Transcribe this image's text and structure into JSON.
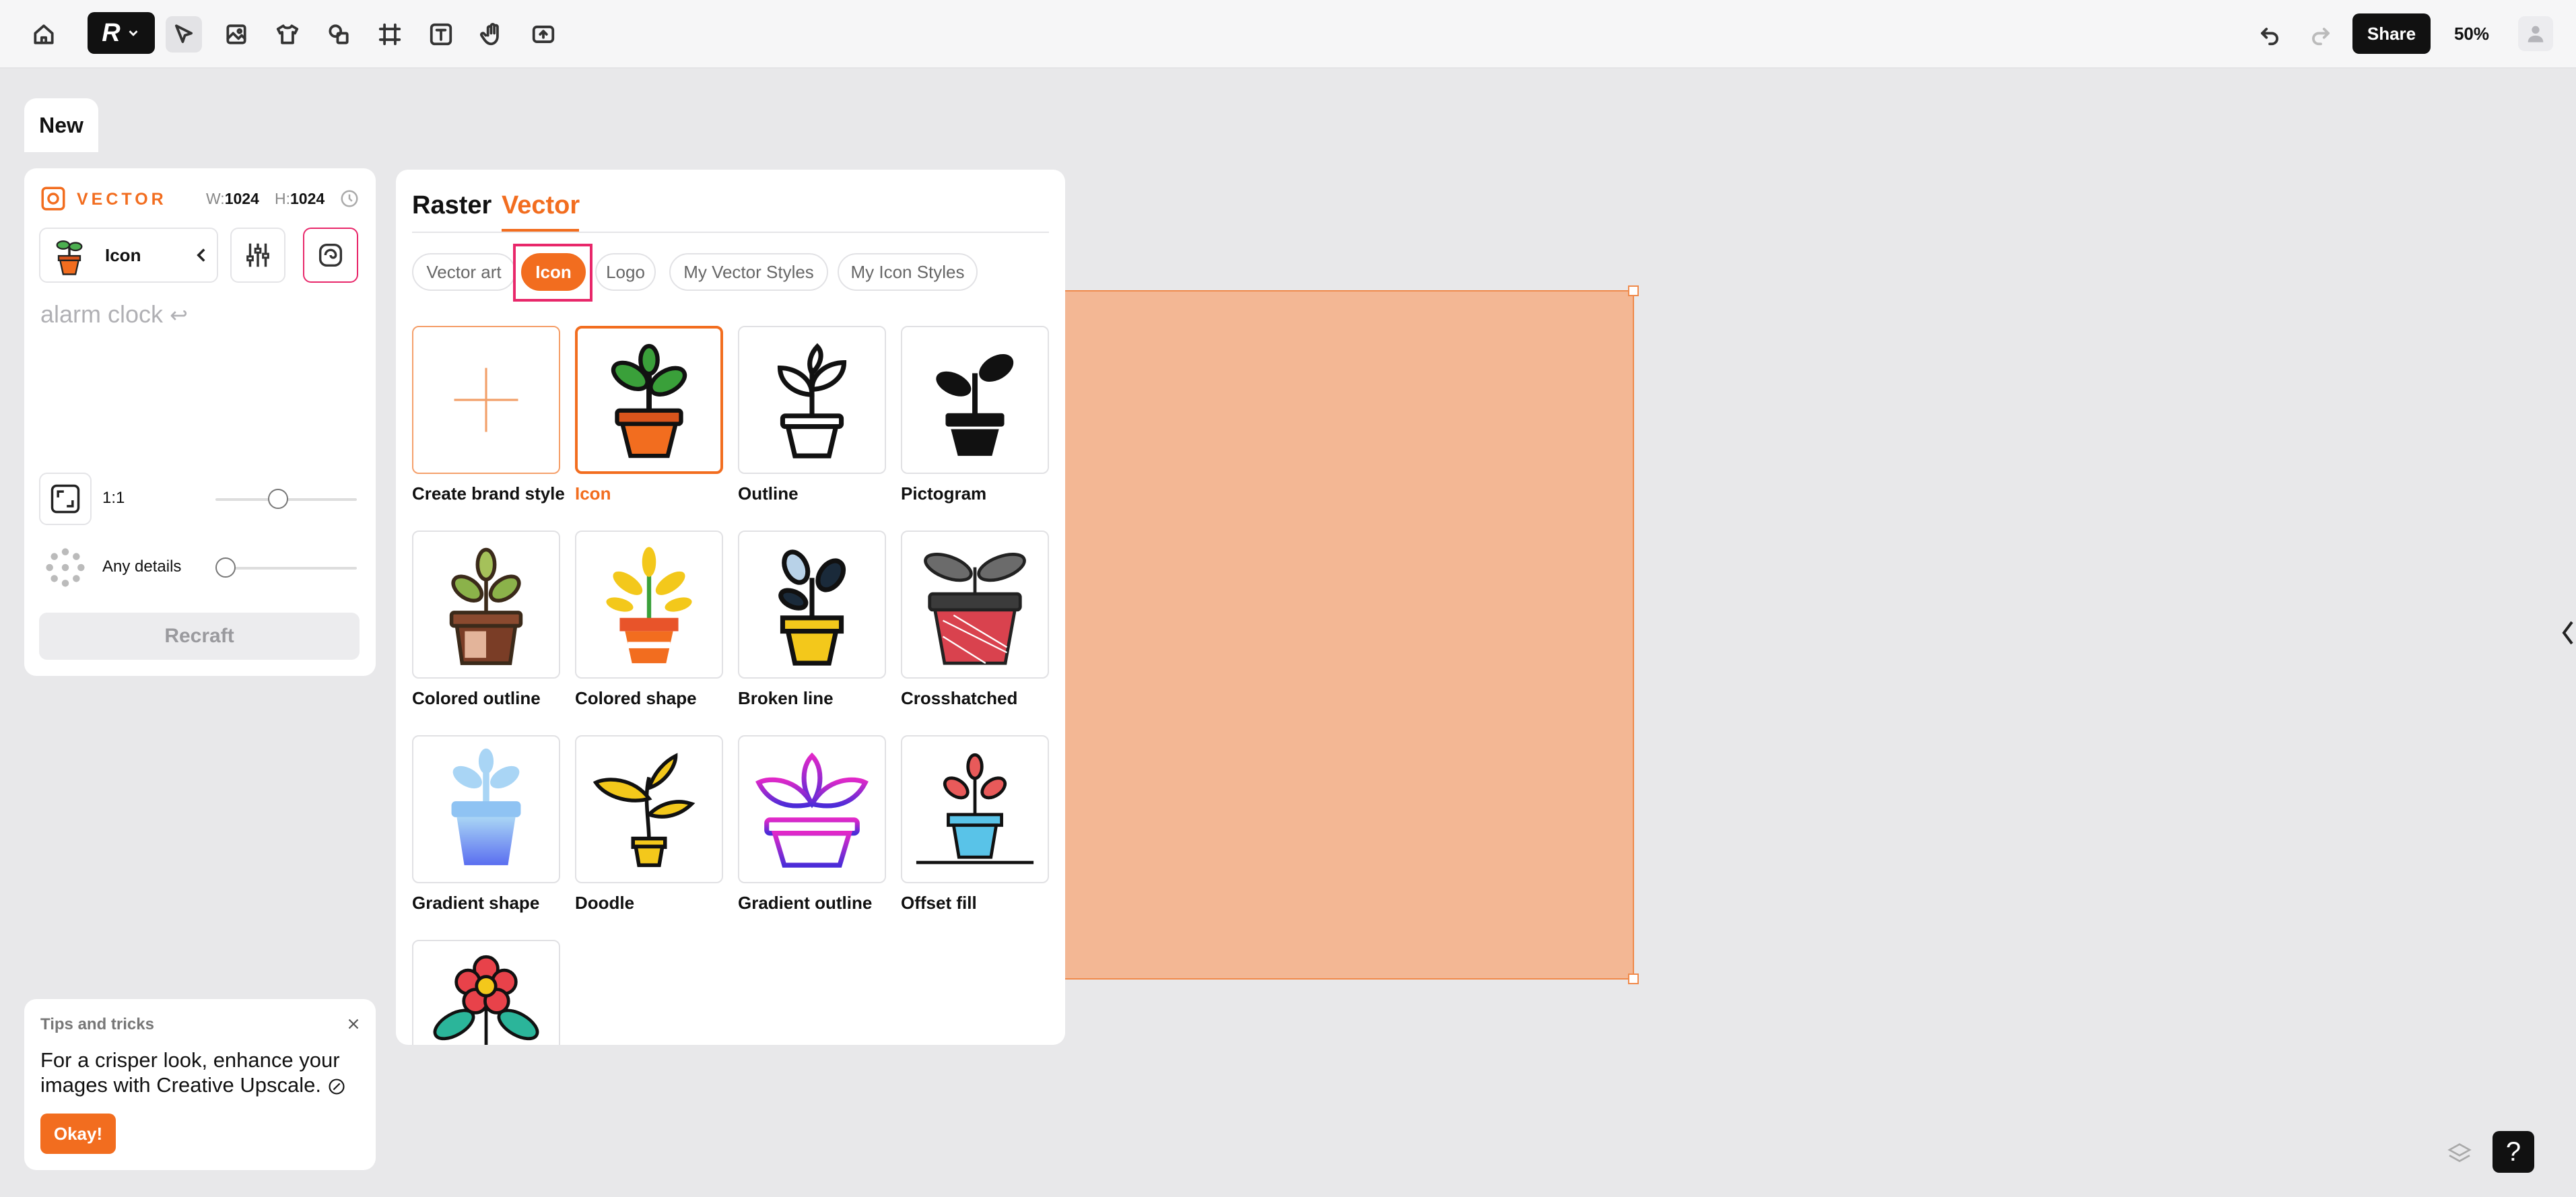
{
  "toolbar": {
    "share_label": "Share",
    "zoom_label": "50%",
    "tools": [
      "home-icon",
      "select-icon",
      "image-frame-icon",
      "mockup-icon",
      "shapes-icon",
      "frame-icon",
      "text-icon",
      "hand-icon",
      "export-icon"
    ]
  },
  "new_tab": {
    "label": "New"
  },
  "left_panel": {
    "mode_label": "VECTOR",
    "w_label": "W:",
    "w_value": "1024",
    "h_label": "H:",
    "h_value": "1024",
    "style_name": "Icon",
    "prompt": "alarm clock",
    "aspect_label": "1:1",
    "details_label": "Any details",
    "recraft_label": "Recraft"
  },
  "style_panel": {
    "tab_raster": "Raster",
    "tab_vector": "Vector",
    "chips": [
      "Vector art",
      "Icon",
      "Logo",
      "My Vector Styles",
      "My Icon Styles"
    ],
    "selected_chip": "Icon",
    "cards": [
      {
        "label": "Create brand style"
      },
      {
        "label": "Icon"
      },
      {
        "label": "Outline"
      },
      {
        "label": "Pictogram"
      },
      {
        "label": "Colored outline"
      },
      {
        "label": "Colored shape"
      },
      {
        "label": "Broken line"
      },
      {
        "label": "Crosshatched"
      },
      {
        "label": "Gradient shape"
      },
      {
        "label": "Doodle"
      },
      {
        "label": "Gradient outline"
      },
      {
        "label": "Offset fill"
      }
    ],
    "selected_card": "Icon"
  },
  "tips": {
    "heading": "Tips and tricks",
    "body": "For a crisper look, enhance your images with Creative Upscale.",
    "okay_label": "Okay!"
  },
  "colors": {
    "accent": "#f26d1f",
    "canvas_fill": "#f3b794",
    "highlight_box": "#e8276a"
  }
}
